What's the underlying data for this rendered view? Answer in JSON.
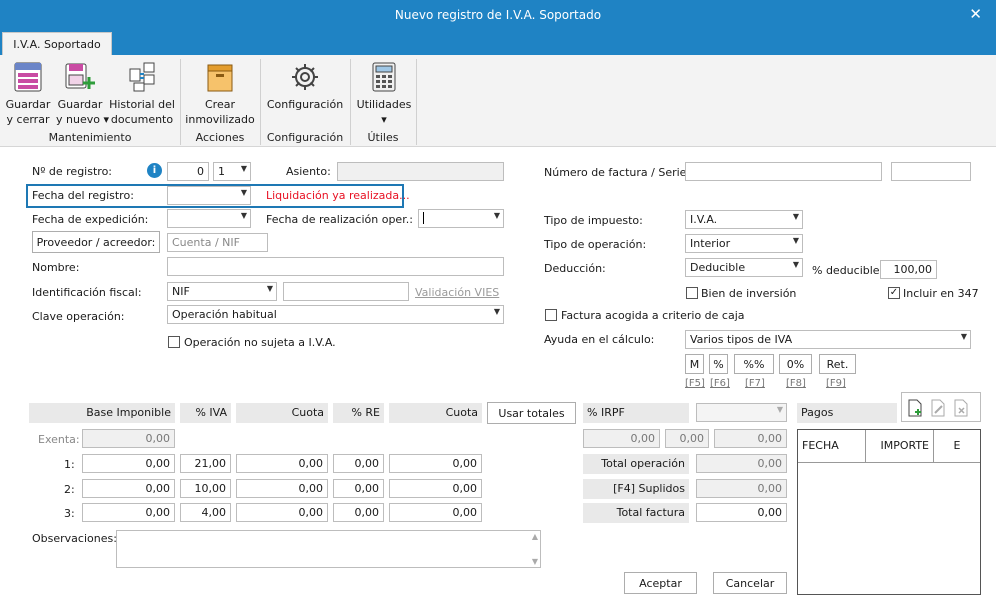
{
  "window": {
    "title": "Nuevo registro de I.V.A. Soportado"
  },
  "tab": {
    "label": "I.V.A. Soportado"
  },
  "ribbon": {
    "guardar_cerrar": "Guardar\ny cerrar",
    "guardar_nuevo": "Guardar\ny nuevo ▾",
    "historial": "Historial del\ndocumento",
    "crear_inmovilizado": "Crear\ninmovilizado",
    "configuracion": "Configuración",
    "utilidades": "Utilidades\n▾",
    "group_mantenimiento": "Mantenimiento",
    "group_acciones": "Acciones",
    "group_configuracion": "Configuración",
    "group_utiles": "Útiles"
  },
  "form": {
    "num_registro_label": "Nº de registro:",
    "num_registro_value": "0",
    "num_registro_serie": "1",
    "asiento_label": "Asiento:",
    "fecha_registro_label": "Fecha del registro:",
    "liquidacion_msg": "Liquidación ya realizada...",
    "fecha_expedicion_label": "Fecha de expedición:",
    "fecha_realizacion_label": "Fecha de realización oper.:",
    "proveedor_button": "Proveedor / acreedor:",
    "cuenta_placeholder": "Cuenta / NIF",
    "nombre_label": "Nombre:",
    "identificacion_label": "Identificación fiscal:",
    "identificacion_value": "NIF",
    "validacion_vies": "Validación VIES",
    "clave_label": "Clave operación:",
    "clave_value": "Operación habitual",
    "no_sujeta_label": "Operación no sujeta a I.V.A.",
    "num_factura_label": "Número de factura / Serie:",
    "tipo_impuesto_label": "Tipo de impuesto:",
    "tipo_impuesto_value": "I.V.A.",
    "tipo_operacion_label": "Tipo de operación:",
    "tipo_operacion_value": "Interior",
    "deduccion_label": "Deducción:",
    "deduccion_value": "Deducible",
    "pct_deducible_label": "% deducible:",
    "pct_deducible_value": "100,00",
    "bien_inversion_label": "Bien de inversión",
    "incluir_347_label": "Incluir en 347",
    "incluir_347_checked": "✓",
    "criterio_caja_label": "Factura acogida a criterio de caja",
    "ayuda_label": "Ayuda en el cálculo:",
    "ayuda_value": "Varios tipos de IVA"
  },
  "calc_buttons": [
    {
      "label": "M",
      "key": "[F5]"
    },
    {
      "label": "%",
      "key": "[F6]"
    },
    {
      "label": "%%",
      "key": "[F7]"
    },
    {
      "label": "0%",
      "key": "[F8]"
    },
    {
      "label": "Ret.",
      "key": "[F9]"
    }
  ],
  "table": {
    "headers": {
      "base": "Base Imponible",
      "iva": "% IVA",
      "cuota1": "Cuota",
      "re": "% RE",
      "cuota2": "Cuota",
      "irpf": "% IRPF"
    },
    "usar_totales": "Usar totales",
    "exenta_label": "Exenta:",
    "exenta_value": "0,00",
    "rows": [
      {
        "n": "1:",
        "base": "0,00",
        "iva": "21,00",
        "cuota1": "0,00",
        "re": "0,00",
        "cuota2": "0,00"
      },
      {
        "n": "2:",
        "base": "0,00",
        "iva": "10,00",
        "cuota1": "0,00",
        "re": "0,00",
        "cuota2": "0,00"
      },
      {
        "n": "3:",
        "base": "0,00",
        "iva": "4,00",
        "cuota1": "0,00",
        "re": "0,00",
        "cuota2": "0,00"
      }
    ],
    "irpf_values": [
      "0,00",
      "0,00",
      "0,00"
    ],
    "total_operacion_label": "Total operación",
    "total_operacion": "0,00",
    "suplidos_label": "[F4] Suplidos",
    "suplidos": "0,00",
    "total_factura_label": "Total factura",
    "total_factura": "0,00"
  },
  "observaciones_label": "Observaciones:",
  "pagos": {
    "title": "Pagos",
    "col_fecha": "FECHA",
    "col_importe": "IMPORTE",
    "col_e": "E"
  },
  "buttons": {
    "aceptar": "Aceptar",
    "cancelar": "Cancelar"
  },
  "colors": {
    "accent": "#1f83c4",
    "error": "#e81123",
    "highlight_border": "#1e78b4"
  }
}
